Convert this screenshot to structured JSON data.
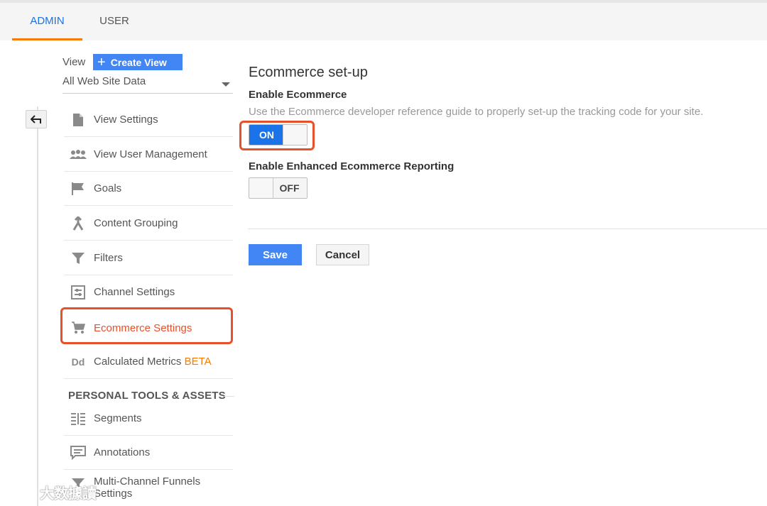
{
  "tabs": {
    "admin": "ADMIN",
    "user": "USER"
  },
  "view": {
    "label": "View",
    "create_button": "Create View",
    "selected": "All Web Site Data"
  },
  "nav": {
    "items": [
      {
        "label": "View Settings",
        "icon": "document-icon"
      },
      {
        "label": "View User Management",
        "icon": "people-icon"
      },
      {
        "label": "Goals",
        "icon": "flag-icon"
      },
      {
        "label": "Content Grouping",
        "icon": "grouping-icon"
      },
      {
        "label": "Filters",
        "icon": "filter-icon"
      },
      {
        "label": "Channel Settings",
        "icon": "channel-settings-icon"
      },
      {
        "label": "Ecommerce Settings",
        "icon": "cart-icon",
        "active": true
      },
      {
        "label": "Calculated Metrics",
        "badge": "BETA",
        "icon": "dd-icon"
      }
    ],
    "section_header": "PERSONAL TOOLS & ASSETS",
    "personal_items": [
      {
        "label": "Segments",
        "icon": "segments-icon"
      },
      {
        "label": "Annotations",
        "icon": "annotation-icon"
      },
      {
        "label": "Multi-Channel Funnels Settings",
        "icon": "funnel-icon"
      }
    ]
  },
  "main": {
    "title": "Ecommerce set-up",
    "enable_ecommerce": {
      "heading": "Enable Ecommerce",
      "description": "Use the Ecommerce developer reference guide to properly set-up the tracking code for your site.",
      "toggle_label": "ON"
    },
    "enhanced": {
      "heading": "Enable Enhanced Ecommerce Reporting",
      "toggle_label": "OFF"
    },
    "save_label": "Save",
    "cancel_label": "Cancel"
  },
  "watermark": "大数據讀",
  "colors": {
    "accent": "#1a73e8",
    "button_blue": "#4285f4",
    "highlight": "#e8502a",
    "tab_underline": "#f57c00"
  }
}
